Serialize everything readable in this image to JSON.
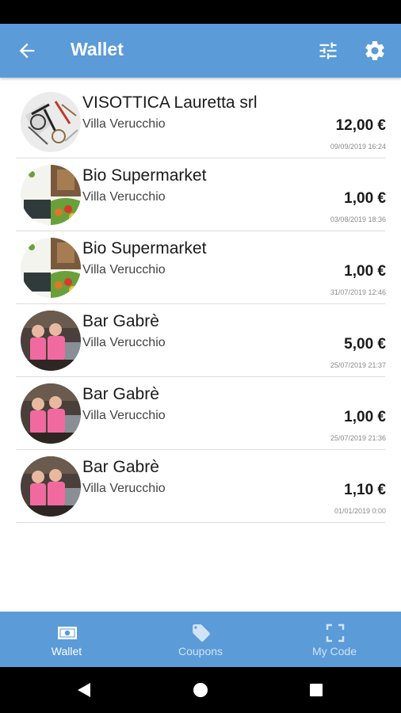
{
  "app_bar": {
    "title": "Wallet",
    "back_icon": "arrow-left-icon",
    "filter_icon": "sliders-icon",
    "settings_icon": "gear-icon",
    "color": "#5a9bd8"
  },
  "transactions": [
    {
      "name": "VISOTTICA Lauretta srl",
      "location": "Villa Verucchio",
      "amount": "12,00 €",
      "date": "09/09/2019 16:24",
      "avatar": "eyeglasses-store-photo"
    },
    {
      "name": "Bio Supermarket",
      "location": "Villa Verucchio",
      "amount": "1,00 €",
      "date": "03/08/2019 18:36",
      "avatar": "bio-supermarket-photo"
    },
    {
      "name": "Bio Supermarket",
      "location": "Villa Verucchio",
      "amount": "1,00 €",
      "date": "31/07/2019 12:46",
      "avatar": "bio-supermarket-photo"
    },
    {
      "name": "Bar Gabrè",
      "location": "Villa Verucchio",
      "amount": "5,00 €",
      "date": "25/07/2019 21:37",
      "avatar": "bar-staff-photo"
    },
    {
      "name": "Bar Gabrè",
      "location": "Villa Verucchio",
      "amount": "1,00 €",
      "date": "25/07/2019 21:36",
      "avatar": "bar-staff-photo"
    },
    {
      "name": "Bar Gabrè",
      "location": "Villa Verucchio",
      "amount": "1,10 €",
      "date": "01/01/2019 0:00",
      "avatar": "bar-staff-photo"
    }
  ],
  "bottom_nav": {
    "tabs": [
      {
        "label": "Wallet",
        "icon": "banknote-icon",
        "active": true
      },
      {
        "label": "Coupons",
        "icon": "tag-icon",
        "active": false
      },
      {
        "label": "My Code",
        "icon": "scan-frame-icon",
        "active": false
      }
    ]
  },
  "system_nav": [
    "back-triangle-icon",
    "home-circle-icon",
    "recents-square-icon"
  ]
}
